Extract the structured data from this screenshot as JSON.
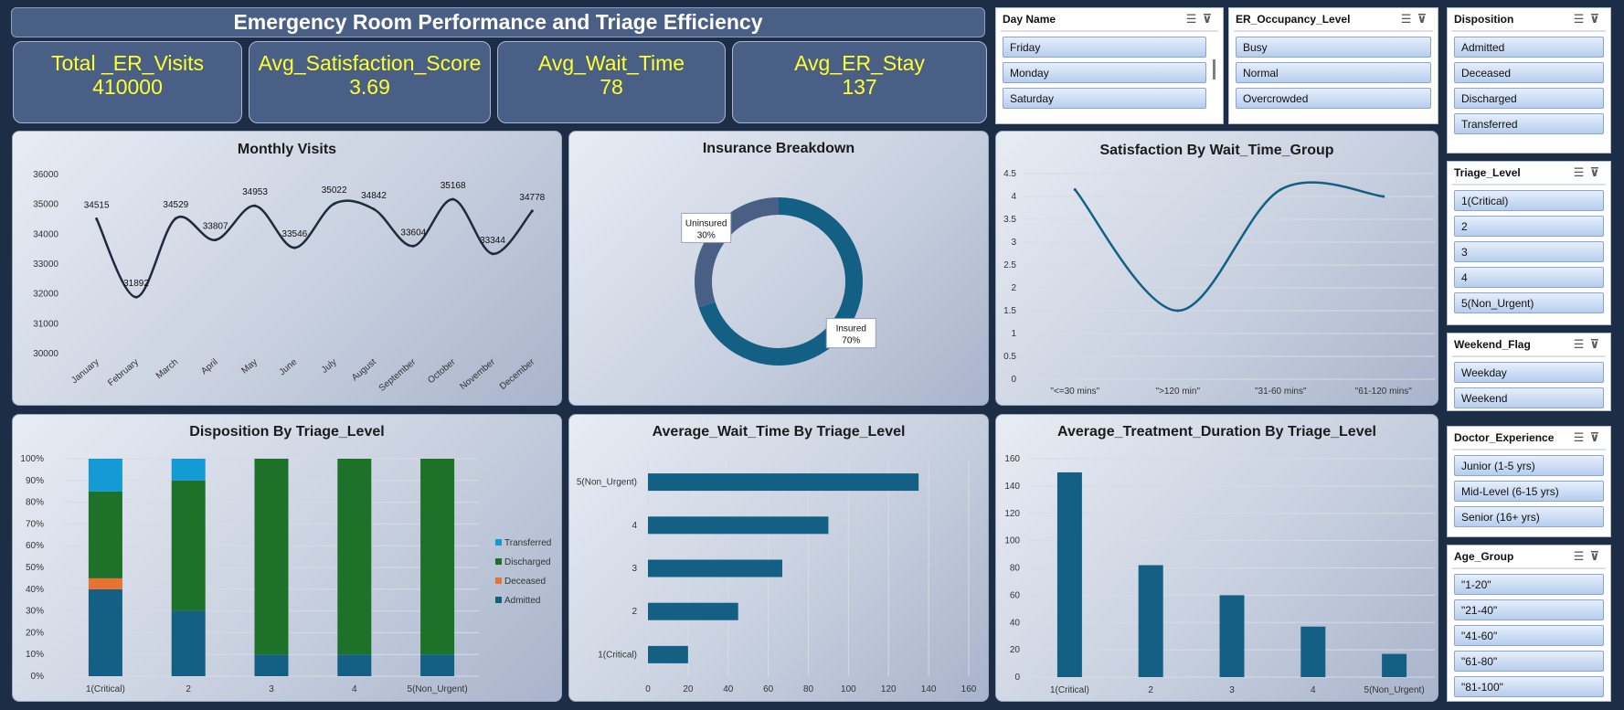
{
  "header": {
    "title": "Emergency Room Performance and Triage Efficiency"
  },
  "kpis": [
    {
      "label": "Total _ER_Visits",
      "value": "410000"
    },
    {
      "label": "Avg_Satisfaction_Score",
      "value": "3.69"
    },
    {
      "label": "Avg_Wait_Time",
      "value": "78"
    },
    {
      "label": "Avg_ER_Stay",
      "value": "137"
    }
  ],
  "slicers": {
    "day_name": {
      "title": "Day Name",
      "items": [
        "Friday",
        "Monday",
        "Saturday"
      ]
    },
    "occupancy": {
      "title": "ER_Occupancy_Level",
      "items": [
        "Busy",
        "Normal",
        "Overcrowded"
      ]
    },
    "disposition": {
      "title": "Disposition",
      "items": [
        "Admitted",
        "Deceased",
        "Discharged",
        "Transferred"
      ]
    },
    "triage": {
      "title": "Triage_Level",
      "items": [
        "1(Critical)",
        "2",
        "3",
        "4",
        "5(Non_Urgent)"
      ]
    },
    "weekend": {
      "title": "Weekend_Flag",
      "items": [
        "Weekday",
        "Weekend"
      ]
    },
    "doctor": {
      "title": "Doctor_Experience",
      "items": [
        "Junior (1-5 yrs)",
        "Mid-Level (6-15 yrs)",
        "Senior (16+ yrs)"
      ]
    },
    "age": {
      "title": "Age_Group",
      "items": [
        "\"1-20\"",
        "\"21-40\"",
        "\"41-60\"",
        "\"61-80\"",
        "\"81-100\""
      ]
    }
  },
  "icons": {
    "multi_select": "multi-select-icon",
    "clear_filter": "clear-filter-icon"
  },
  "colors": {
    "accent": "#ffff2e",
    "primary_series": "#145f84",
    "donut_secondary": "#4a5f86",
    "line": "#1f2a3c",
    "transferred": "#149ad4",
    "discharged": "#1e7128",
    "deceased": "#ea7231",
    "admitted": "#145f84"
  },
  "chart_data": [
    {
      "id": "monthly",
      "type": "line",
      "title": "Monthly Visits",
      "categories": [
        "January",
        "February",
        "March",
        "April",
        "May",
        "June",
        "July",
        "August",
        "September",
        "October",
        "November",
        "December"
      ],
      "values": [
        34515,
        31892,
        34529,
        33807,
        34953,
        33546,
        35022,
        34842,
        33604,
        35168,
        33344,
        34778
      ],
      "ylim": [
        30000,
        36000
      ],
      "yticks": [
        30000,
        31000,
        32000,
        33000,
        34000,
        35000,
        36000
      ],
      "grid": false
    },
    {
      "id": "insurance",
      "type": "pie",
      "title": "Insurance Breakdown",
      "slices": [
        {
          "label": "Insured",
          "value": 70,
          "text": "70%"
        },
        {
          "label": "Uninsured",
          "value": 30,
          "text": "30%"
        }
      ]
    },
    {
      "id": "satisfaction",
      "type": "line",
      "title": "Satisfaction By Wait_Time_Group",
      "categories": [
        "\"<=30 mins\"",
        "\">120 min\"",
        "\"31-60 mins\"",
        "\"61-120 mins\""
      ],
      "values": [
        4.15,
        1.5,
        4.15,
        4.0
      ],
      "ylim": [
        0,
        4.5
      ],
      "yticks": [
        "0",
        "0.5",
        "1",
        "1.5",
        "2",
        "2.5",
        "3",
        "3.5",
        "4",
        "4.5"
      ],
      "grid": true
    },
    {
      "id": "disposition",
      "type": "bar",
      "title": "Disposition By Triage_Level",
      "categories": [
        "1(Critical)",
        "2",
        "3",
        "4",
        "5(Non_Urgent)"
      ],
      "series": [
        {
          "name": "Admitted",
          "values": [
            40,
            30,
            10,
            10,
            10
          ]
        },
        {
          "name": "Deceased",
          "values": [
            5,
            0,
            0,
            0,
            0
          ]
        },
        {
          "name": "Discharged",
          "values": [
            40,
            60,
            90,
            90,
            90
          ]
        },
        {
          "name": "Transferred",
          "values": [
            15,
            10,
            0,
            0,
            0
          ]
        }
      ],
      "legend": [
        "Transferred",
        "Discharged",
        "Deceased",
        "Admitted"
      ],
      "yticks": [
        "0%",
        "10%",
        "20%",
        "30%",
        "40%",
        "50%",
        "60%",
        "70%",
        "80%",
        "90%",
        "100%"
      ],
      "legend_position": "right"
    },
    {
      "id": "waittime",
      "type": "bar",
      "title": "Average_Wait_Time By Triage_Level",
      "orientation": "horizontal",
      "categories": [
        "5(Non_Urgent)",
        "4",
        "3",
        "2",
        "1(Critical)"
      ],
      "values": [
        135,
        90,
        67,
        45,
        20
      ],
      "xlim": [
        0,
        160
      ],
      "xticks": [
        "0",
        "20",
        "40",
        "60",
        "80",
        "100",
        "120",
        "140",
        "160"
      ],
      "grid": true
    },
    {
      "id": "treatment",
      "type": "bar",
      "title": "Average_Treatment_Duration By Triage_Level",
      "categories": [
        "1(Critical)",
        "2",
        "3",
        "4",
        "5(Non_Urgent)"
      ],
      "values": [
        150,
        82,
        60,
        37,
        17
      ],
      "ylim": [
        0,
        160
      ],
      "yticks": [
        "0",
        "20",
        "40",
        "60",
        "80",
        "100",
        "120",
        "140",
        "160"
      ],
      "grid": true
    }
  ]
}
